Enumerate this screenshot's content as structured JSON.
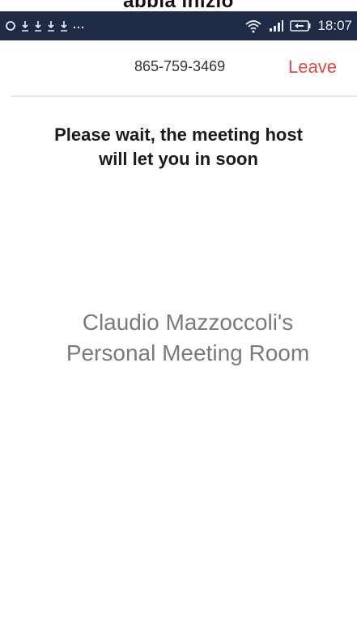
{
  "caption": {
    "text": "abbia inizio"
  },
  "status_bar": {
    "left_icons": [
      "location-icon",
      "download-icon",
      "download-icon",
      "download-icon",
      "download-icon",
      "more-icon"
    ],
    "right_icons": [
      "wifi-icon",
      "signal-icon",
      "battery-icon"
    ],
    "time": "18:07"
  },
  "header": {
    "meeting_id": "865-759-3469",
    "leave_label": "Leave"
  },
  "main": {
    "wait_line1": "Please wait, the meeting host",
    "wait_line2": "will let you in soon",
    "room_line1": "Claudio Mazzoccoli's",
    "room_line2": "Personal Meeting Room"
  },
  "colors": {
    "status_bar_bg": "#1f2a44",
    "leave_red": "#e0484a",
    "room_text_gray": "#7a7a7a"
  }
}
